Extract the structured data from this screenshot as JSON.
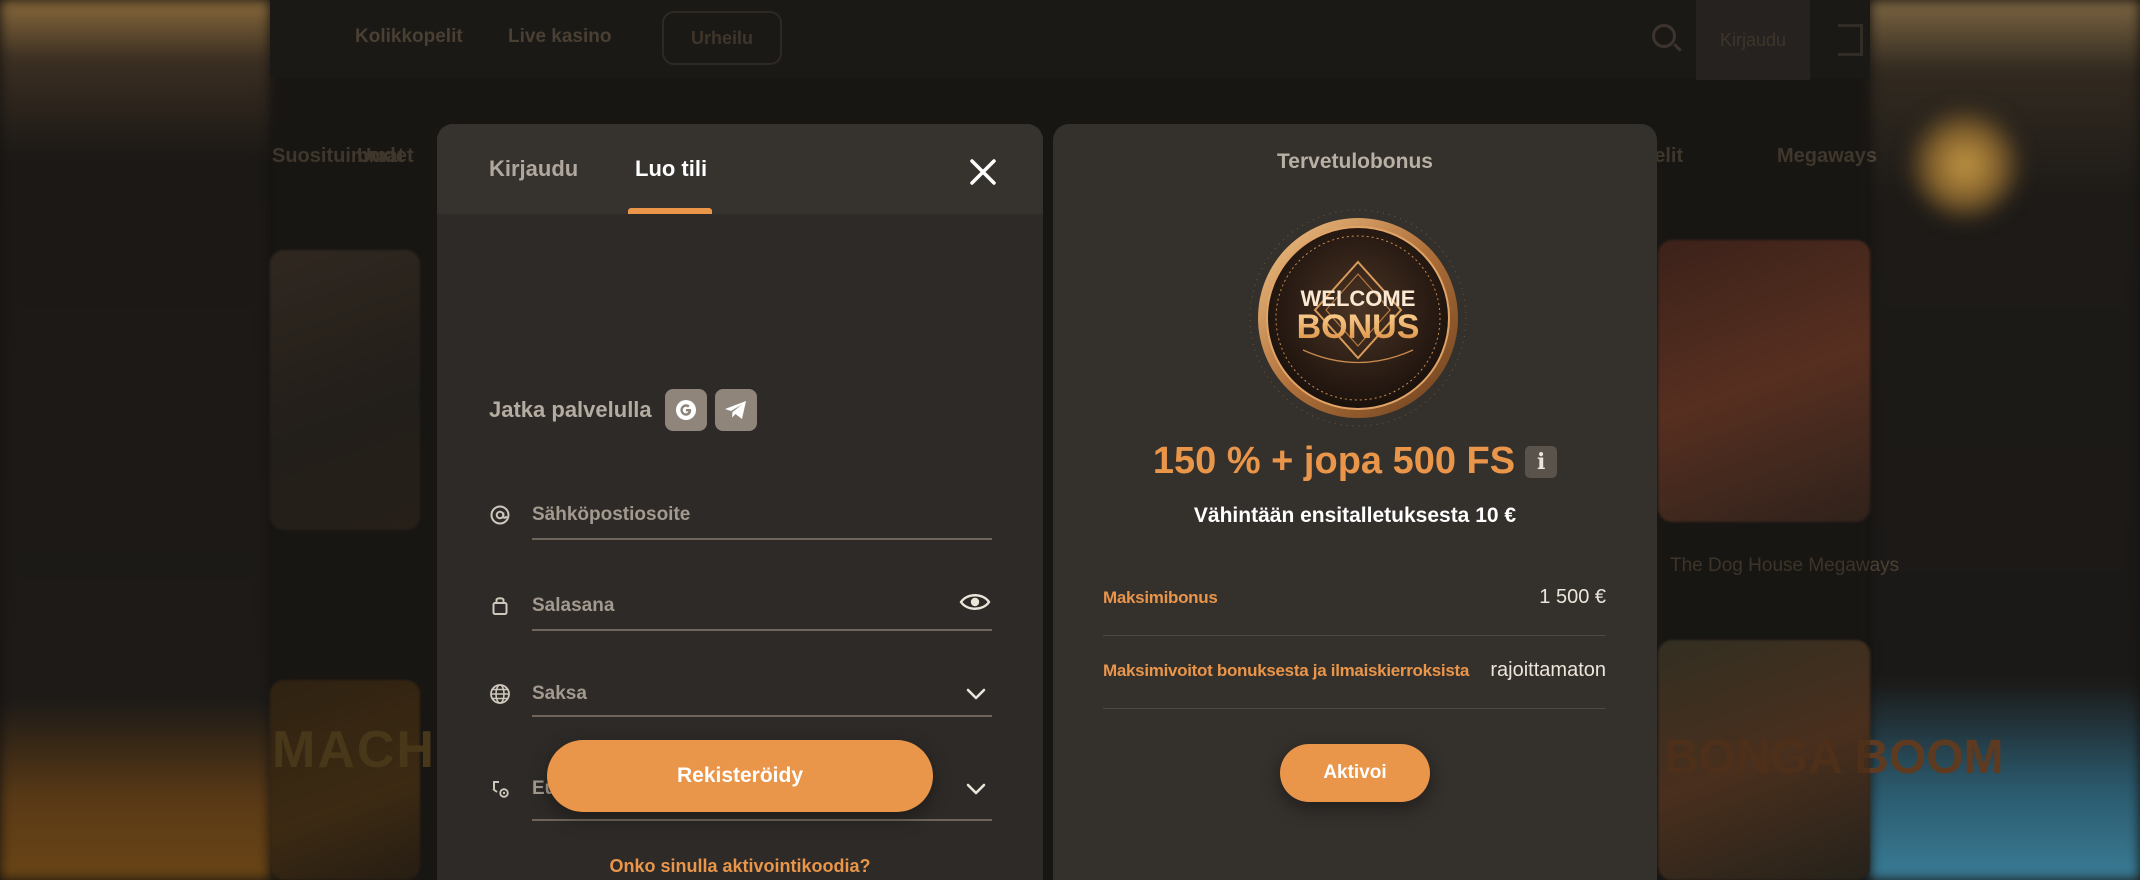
{
  "background": {
    "nav": [
      "Kolikkopelit",
      "Live kasino",
      "Urheilu"
    ],
    "login_button": "Kirjaudu",
    "categories": [
      "Suosituimmat",
      "Uudet",
      "pelit",
      "Megaways"
    ],
    "tile_label": "The Dog House Megaways",
    "tile_machine": "MACHINE",
    "tile_boom": "BONGA BOOM"
  },
  "auth": {
    "tabs": [
      {
        "label": "Kirjaudu",
        "active": false
      },
      {
        "label": "Luo tili",
        "active": true
      }
    ],
    "social_label": "Jatka palvelulla",
    "social_buttons": [
      "google-icon",
      "telegram-icon"
    ],
    "email_placeholder": "Sähköpostiosoite",
    "password_placeholder": "Salasana",
    "country_value": "Saksa",
    "currency_value": "Euro",
    "register_label": "Rekisteröidy",
    "activation_link": "Onko sinulla aktivointikoodia?"
  },
  "bonus": {
    "title": "Tervetulobonus",
    "coin_line1": "WELCOME",
    "coin_line2": "BONUS",
    "headline": "150 % + jopa 500 FS",
    "info_label": "i",
    "subtitle": "Vähintään ensitalletuksesta 10 €",
    "rows": [
      {
        "label": "Maksimibonus",
        "value": "1 500 €"
      },
      {
        "label": "Maksimivoitot bonuksesta ja ilmaiskierroksista",
        "value": "rajoittamaton"
      }
    ],
    "activate_label": "Aktivoi"
  },
  "colors": {
    "accent": "#e9954a",
    "card": "#34302c",
    "card_body": "#2d2a27",
    "text_muted": "#a39a8f"
  }
}
